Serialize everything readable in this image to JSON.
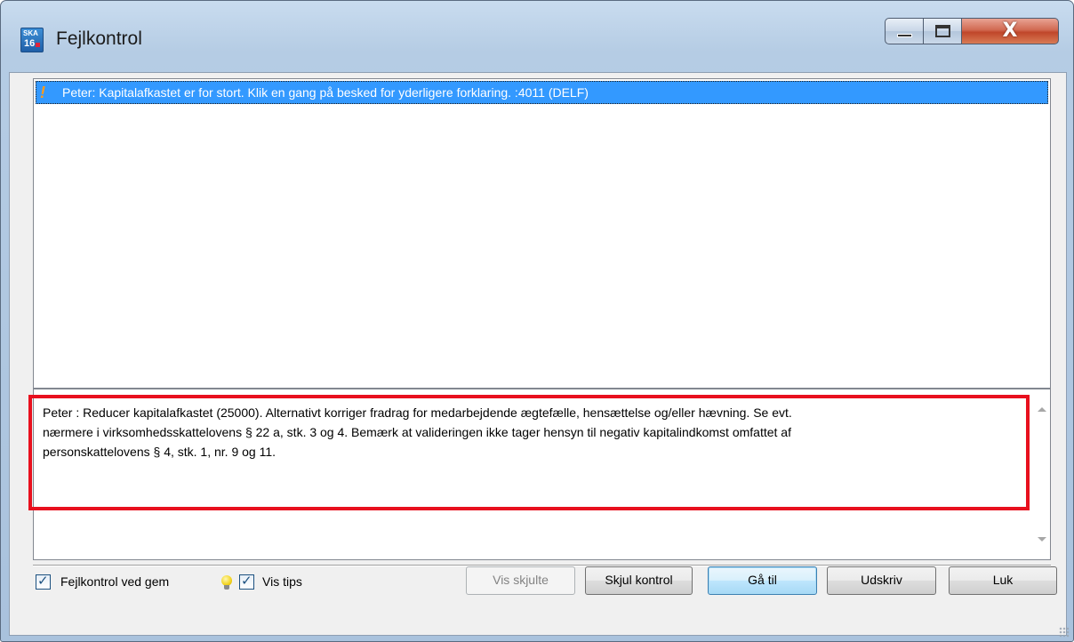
{
  "window": {
    "title": "Fejlkontrol",
    "app_icon_text_top": "SKA",
    "app_icon_text_bottom": "16",
    "close_label": "X"
  },
  "error_list": {
    "items": [
      {
        "text": "Peter: Kapitalafkastet er for stort. Klik en gang på besked for yderligere forklaring.  :4011 (DELF)",
        "selected": true,
        "icon": "warning-exclamation-icon"
      }
    ]
  },
  "detail": {
    "text": "Peter : Reducer kapitalafkastet (25000). Alternativt korriger fradrag for medarbejdende ægtefælle, hensættelse og/eller hævning. Se evt.\nnærmere i virksomhedsskattelovens § 22 a, stk. 3 og 4. Bemærk at valideringen ikke tager hensyn til negativ kapitalindkomst omfattet af\npersonskattelovens § 4, stk. 1, nr. 9 og 11."
  },
  "footer": {
    "checkbox_fejlkontrol": {
      "label": "Fejlkontrol ved gem",
      "checked": true
    },
    "checkbox_vis_tips": {
      "label": "Vis tips",
      "checked": true
    },
    "buttons": {
      "vis_skjulte": "Vis skjulte",
      "skjul_kontrol": "Skjul kontrol",
      "gaa_til": "Gå til",
      "udskriv": "Udskriv",
      "luk": "Luk"
    }
  },
  "colors": {
    "selection": "#3399ff",
    "highlight_box": "#e8101e"
  }
}
